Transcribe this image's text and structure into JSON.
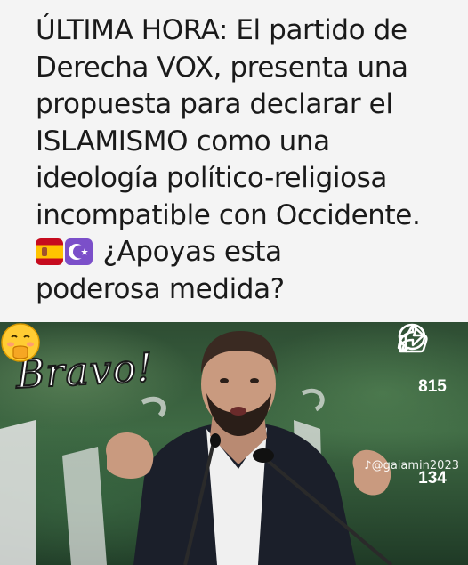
{
  "post": {
    "headline_lines": [
      "ÚLTIMA HORA: El partido de",
      "Derecha VOX, presenta una",
      "propuesta para declarar el",
      "ISLAMISMO como una",
      "ideología político-religiosa",
      "incompatible con Occidente."
    ],
    "question_line1": "¿Apoyas esta",
    "question_line2": "poderosa medida?",
    "flag_emoji": "spain-flag-emoji",
    "symbol_emoji": "star-and-crescent-emoji"
  },
  "overlay": {
    "sticker_text": "Bravo!",
    "sticker_emoji": "hand-over-mouth-face-emoji",
    "watermark": "@gaiamin2023"
  },
  "actions": {
    "likes": "815",
    "comments": "134"
  },
  "icons": {
    "like": "thumbs-up-icon",
    "comment": "comment-bubble-icon",
    "share": "share-arrow-icon",
    "tiktok": "tiktok-icon"
  },
  "colors": {
    "card_bg": "#f4f4f4",
    "text": "#1a1a1a",
    "symbol_bg": "#7b4fc9"
  }
}
